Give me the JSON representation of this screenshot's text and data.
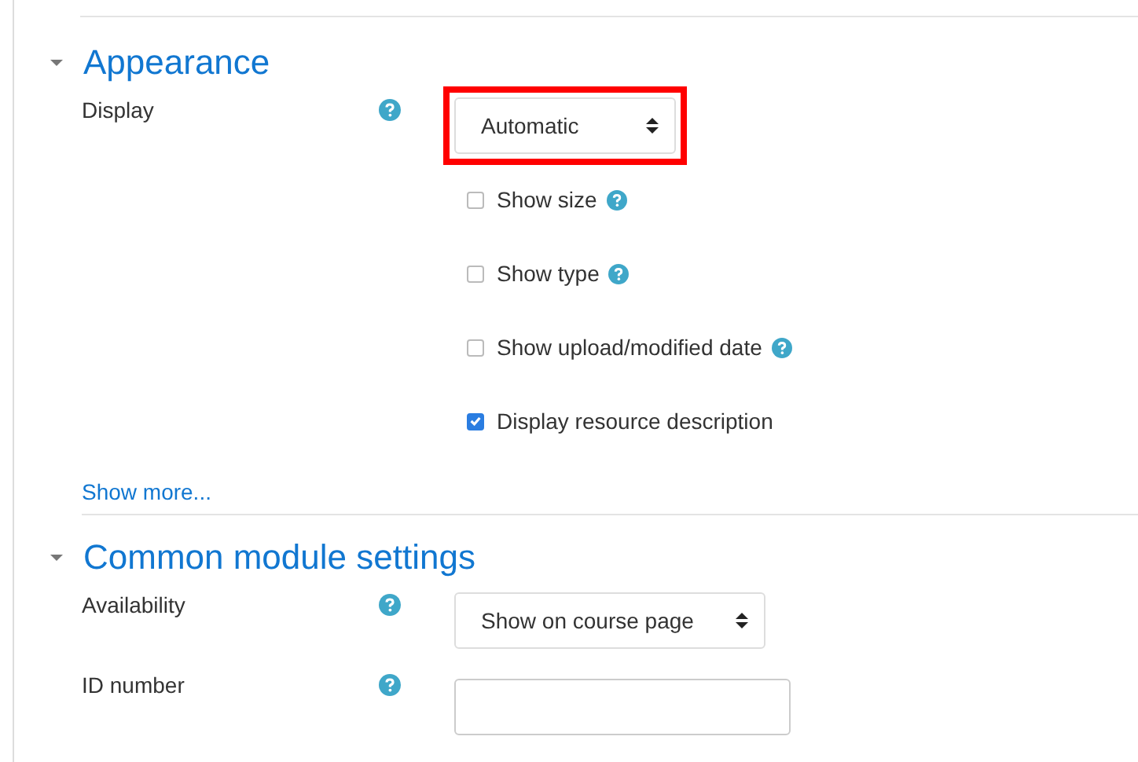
{
  "sections": [
    {
      "title": "Appearance",
      "expanded": true,
      "fields": [
        {
          "kind": "select",
          "label": "Display",
          "help": true,
          "value": "Automatic",
          "highlighted": true
        },
        {
          "kind": "checkbox",
          "label": "Show size",
          "help": true,
          "checked": false
        },
        {
          "kind": "checkbox",
          "label": "Show type",
          "help": true,
          "checked": false
        },
        {
          "kind": "checkbox",
          "label": "Show upload/modified date",
          "help": true,
          "checked": false
        },
        {
          "kind": "checkbox",
          "label": "Display resource description",
          "help": false,
          "checked": true
        }
      ],
      "more_link": "Show more..."
    },
    {
      "title": "Common module settings",
      "expanded": true,
      "fields": [
        {
          "kind": "select",
          "label": "Availability",
          "help": true,
          "value": "Show on course page",
          "highlighted": false
        },
        {
          "kind": "text",
          "label": "ID number",
          "help": true
        }
      ]
    }
  ]
}
